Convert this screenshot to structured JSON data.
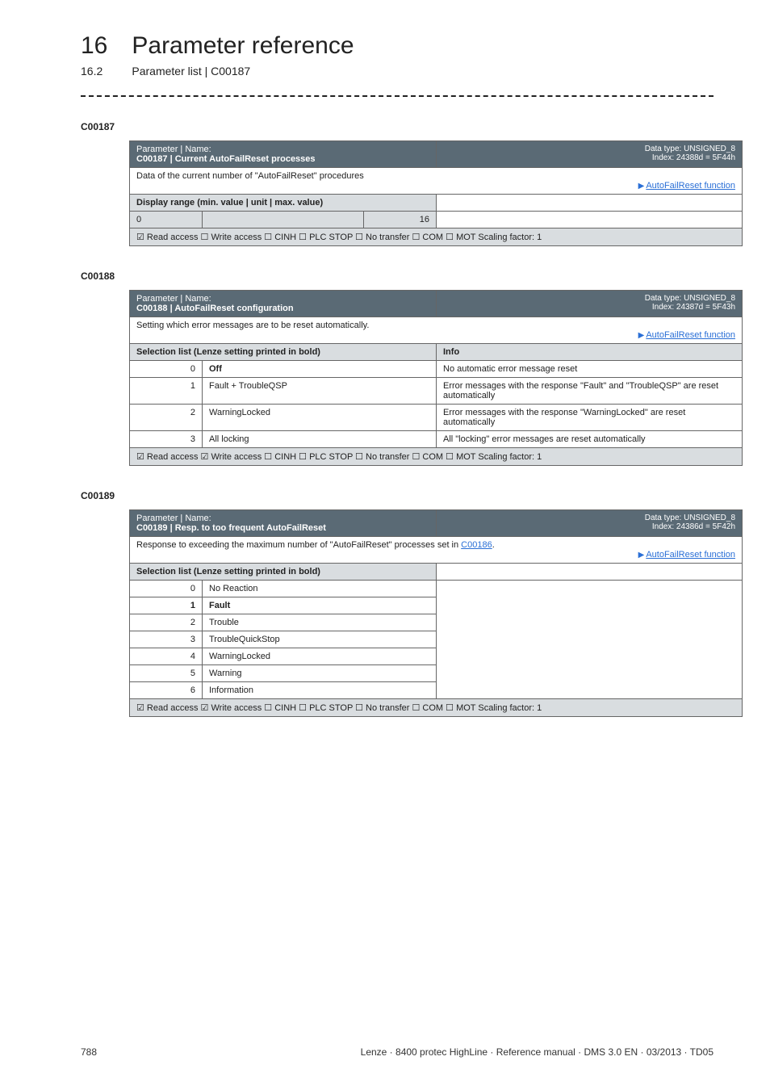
{
  "header": {
    "chapter_num": "16",
    "chapter_title": "Parameter reference",
    "sub_num": "16.2",
    "sub_title": "Parameter list | C00187"
  },
  "sections": {
    "c00187": {
      "code": "C00187",
      "param_label": "Parameter | Name:",
      "param_name": "C00187 | Current AutoFailReset processes",
      "datatype_l1": "Data type: UNSIGNED_8",
      "datatype_l2": "Index: 24388d = 5F44h",
      "desc": "Data of the current number of \"AutoFailReset\" procedures",
      "link": "AutoFailReset function",
      "display_range_label": "Display range (min. value | unit | max. value)",
      "min": "0",
      "unit": "",
      "max": "16",
      "access": "☑ Read access   ☐ Write access   ☐ CINH   ☐ PLC STOP   ☐ No transfer   ☐ COM   ☐ MOT     Scaling factor: 1"
    },
    "c00188": {
      "code": "C00188",
      "param_label": "Parameter | Name:",
      "param_name": "C00188 | AutoFailReset configuration",
      "datatype_l1": "Data type: UNSIGNED_8",
      "datatype_l2": "Index: 24387d = 5F43h",
      "desc": "Setting which error messages are to be reset automatically.",
      "link": "AutoFailReset function",
      "sel_label": "Selection list (Lenze setting printed in bold)",
      "info_label": "Info",
      "rows": [
        {
          "n": "0",
          "name": "Off",
          "bold": true,
          "info": "No automatic error message reset"
        },
        {
          "n": "1",
          "name": "Fault + TroubleQSP",
          "bold": false,
          "info": "Error messages with the response \"Fault\" and \"TroubleQSP\" are reset automatically"
        },
        {
          "n": "2",
          "name": "WarningLocked",
          "bold": false,
          "info": "Error messages with the response \"WarningLocked\" are reset automatically"
        },
        {
          "n": "3",
          "name": "All locking",
          "bold": false,
          "info": "All \"locking\" error messages are reset automatically"
        }
      ],
      "access": "☑ Read access   ☑ Write access   ☐ CINH   ☐ PLC STOP   ☐ No transfer   ☐ COM   ☐ MOT     Scaling factor: 1"
    },
    "c00189": {
      "code": "C00189",
      "param_label": "Parameter | Name:",
      "param_name": "C00189 | Resp. to too frequent AutoFailReset",
      "datatype_l1": "Data type: UNSIGNED_8",
      "datatype_l2": "Index: 24386d = 5F42h",
      "desc_pre": "Response to exceeding the maximum number of \"AutoFailReset\" processes set in ",
      "desc_link": "C00186",
      "desc_post": ".",
      "link": "AutoFailReset function",
      "sel_label": "Selection list (Lenze setting printed in bold)",
      "rows": [
        {
          "n": "0",
          "name": "No Reaction",
          "bold": false
        },
        {
          "n": "1",
          "name": "Fault",
          "bold": true
        },
        {
          "n": "2",
          "name": "Trouble",
          "bold": false
        },
        {
          "n": "3",
          "name": "TroubleQuickStop",
          "bold": false
        },
        {
          "n": "4",
          "name": "WarningLocked",
          "bold": false
        },
        {
          "n": "5",
          "name": "Warning",
          "bold": false
        },
        {
          "n": "6",
          "name": "Information",
          "bold": false
        }
      ],
      "access": "☑ Read access   ☑ Write access   ☐ CINH   ☐ PLC STOP   ☐ No transfer   ☐ COM   ☐ MOT     Scaling factor: 1"
    }
  },
  "footer": {
    "page": "788",
    "info": "Lenze · 8400 protec HighLine · Reference manual · DMS 3.0 EN · 03/2013 · TD05"
  }
}
